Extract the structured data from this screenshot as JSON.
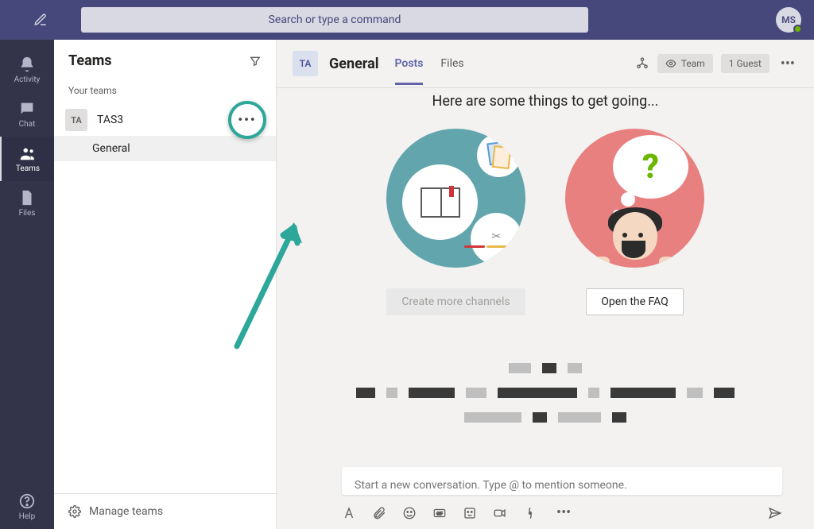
{
  "colors": {
    "accent": "#6264a7",
    "topbar": "#46477a",
    "rail": "#33344a",
    "highlight": "#2ca79a"
  },
  "top": {
    "search_placeholder": "Search or type a command",
    "avatar_initials": "MS"
  },
  "rail": {
    "items": [
      {
        "id": "activity",
        "label": "Activity"
      },
      {
        "id": "chat",
        "label": "Chat"
      },
      {
        "id": "teams",
        "label": "Teams"
      },
      {
        "id": "files",
        "label": "Files"
      }
    ],
    "help_label": "Help"
  },
  "teams_panel": {
    "title": "Teams",
    "your_teams_label": "Your teams",
    "team": {
      "tile": "TA",
      "name": "TAS3"
    },
    "channel_name": "General",
    "manage_label": "Manage teams"
  },
  "channel": {
    "tile": "TA",
    "name": "General",
    "tabs": [
      {
        "label": "Posts",
        "active": true
      },
      {
        "label": "Files",
        "active": false
      }
    ],
    "badges": {
      "team": "Team",
      "guest": "1 Guest"
    },
    "get_going": "Here are some things to get going...",
    "card_channels_btn": "Create more channels",
    "card_faq_btn": "Open the FAQ",
    "compose_placeholder": "Start a new conversation. Type @ to mention someone."
  }
}
